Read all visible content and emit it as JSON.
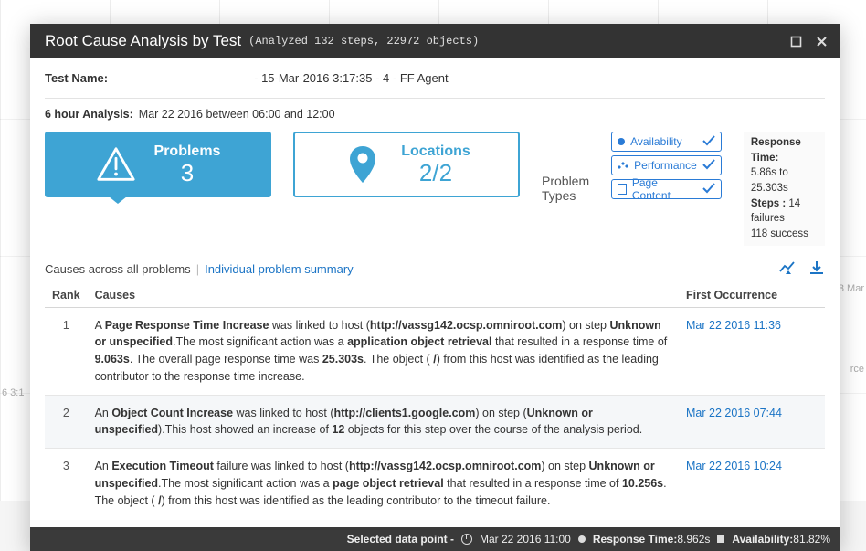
{
  "titlebar": {
    "title": "Root Cause Analysis by Test",
    "subtitle": "(Analyzed 132 steps, 22972 objects)"
  },
  "test_name": {
    "label": "Test Name:",
    "value": "",
    "suffix": "- 15-Mar-2016 3:17:35 - 4 - FF Agent"
  },
  "analysis": {
    "label": "6 hour Analysis:",
    "range": "Mar 22 2016  between 06:00 and 12:00"
  },
  "tiles": {
    "problems": {
      "label": "Problems",
      "value": "3"
    },
    "locations": {
      "label": "Locations",
      "value": "2/2"
    }
  },
  "problem_types": {
    "label": "Problem Types",
    "chips": {
      "availability": "Availability",
      "performance": "Performance",
      "page_content": "Page Content"
    }
  },
  "stats": {
    "response_time_label": "Response Time:",
    "response_time_value": "5.86s to 25.303s",
    "steps_label": "Steps :",
    "steps_fail": "14 failures",
    "steps_success": "118 success"
  },
  "causes_header": {
    "all": "Causes across all problems",
    "summary_link": "Individual problem summary"
  },
  "table": {
    "headers": {
      "rank": "Rank",
      "causes": "Causes",
      "first": "First Occurrence"
    },
    "rows": [
      {
        "rank": "1",
        "text_plain": "A Page Response Time Increase was linked to host (http://vassg142.ocsp.omniroot.com) on step Unknown or unspecified.The most significant action was a application object retrieval that resulted in a response time of 9.063s. The overall page response time was 25.303s. The object ( /) from this host was identified as the leading contributor to the response time increase.",
        "html": "A <b>Page Response Time Increase</b> was linked to host (<b>http://vassg142.ocsp.omniroot.com</b>) on step <b>Unknown or unspecified</b>.The most significant action was a <b>application object retrieval</b> that resulted in a response time of <b>9.063s</b>. The overall page response time was <b>25.303s</b>. The object ( <b>/</b>) from this host was identified as the leading contributor to the response time increase.",
        "first": "Mar 22 2016 11:36"
      },
      {
        "rank": "2",
        "text_plain": "An Object Count Increase was linked to host (http://clients1.google.com) on step (Unknown or unspecified).This host showed an increase of 12 objects for this step over the course of the analysis period.",
        "html": "An <b>Object Count Increase</b> was linked to host (<b>http://clients1.google.com</b>) on step (<b>Unknown or unspecified</b>).This host showed an increase of <b>12</b> objects for this step over the course of the analysis period.",
        "first": "Mar 22 2016 07:44"
      },
      {
        "rank": "3",
        "text_plain": "An Execution Timeout failure was linked to host (http://vassg142.ocsp.omniroot.com) on step Unknown or unspecified.The most significant action was a page object retrieval that resulted in a response time of 10.256s. The object ( /) from this host was identified as the leading contributor to the timeout failure.",
        "html": "An <b>Execution Timeout</b> failure was linked to host (<b>http://vassg142.ocsp.omniroot.com</b>) on step <b>Unknown or unspecified</b>.The most significant action was a <b>page object retrieval</b> that resulted in a response time of <b>10.256s</b>. The object ( <b>/</b>) from this host was identified as the leading contributor to the timeout failure.",
        "first": "Mar 22 2016 10:24"
      }
    ]
  },
  "footer": {
    "selected_label": "Selected data point -",
    "time": "Mar 22 2016 11:00",
    "response_label": "Response Time:",
    "response_value": "8.962s",
    "avail_label": "Availability:",
    "avail_value": "81.82%"
  },
  "bg": {
    "left_axis": "6 3:1",
    "right_1": "3 Mar",
    "right_2": "rce"
  }
}
